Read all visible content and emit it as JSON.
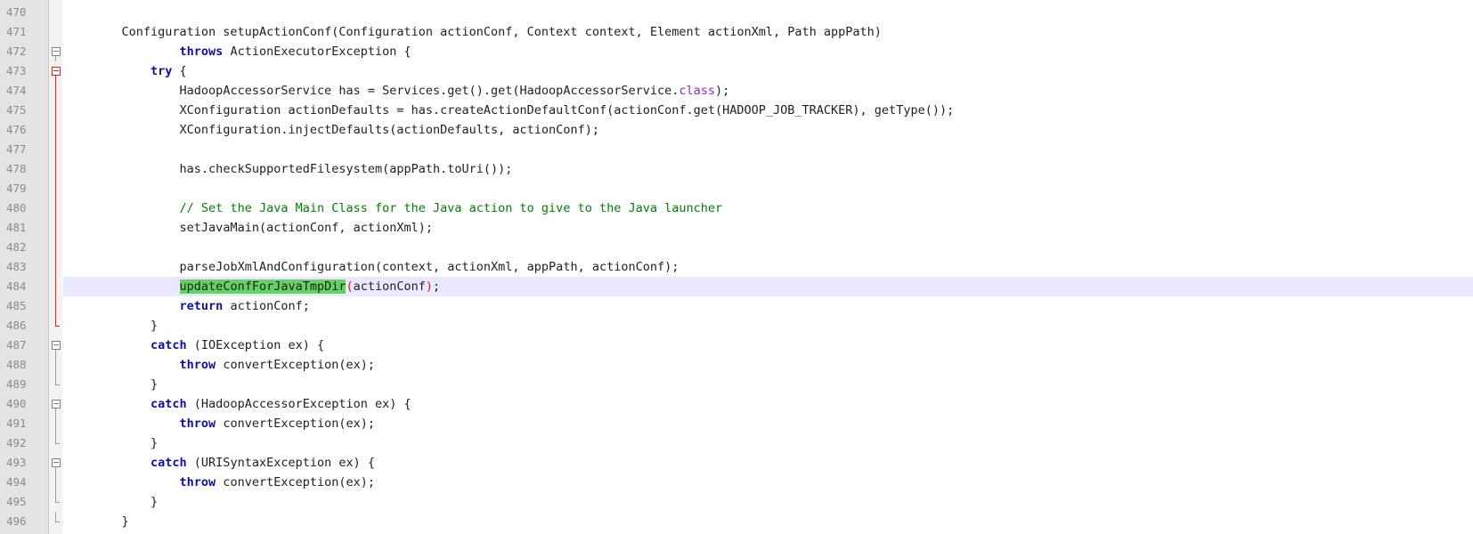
{
  "editor": {
    "lines": [
      {
        "num": "470",
        "fold": "none",
        "indent": "",
        "tokens": []
      },
      {
        "num": "471",
        "fold": "none",
        "indent": "    ",
        "tokens": [
          {
            "t": "plain",
            "v": "Configuration setupActionConf(Configuration actionConf, Context context, Element actionXml, Path appPath)"
          }
        ]
      },
      {
        "num": "472",
        "fold": "box",
        "indent": "            ",
        "tokens": [
          {
            "t": "kw",
            "v": "throws"
          },
          {
            "t": "plain",
            "v": " ActionExecutorException {"
          }
        ]
      },
      {
        "num": "473",
        "fold": "box-red",
        "indent": "        ",
        "tokens": [
          {
            "t": "kw",
            "v": "try"
          },
          {
            "t": "plain",
            "v": " {"
          }
        ]
      },
      {
        "num": "474",
        "fold": "line-red",
        "indent": "            ",
        "tokens": [
          {
            "t": "plain",
            "v": "HadoopAccessorService has = Services.get().get(HadoopAccessorService."
          },
          {
            "t": "cls",
            "v": "class"
          },
          {
            "t": "plain",
            "v": ");"
          }
        ]
      },
      {
        "num": "475",
        "fold": "line-red",
        "indent": "            ",
        "tokens": [
          {
            "t": "plain",
            "v": "XConfiguration actionDefaults = has.createActionDefaultConf(actionConf.get(HADOOP_JOB_TRACKER), getType());"
          }
        ]
      },
      {
        "num": "476",
        "fold": "line-red",
        "indent": "            ",
        "tokens": [
          {
            "t": "plain",
            "v": "XConfiguration.injectDefaults(actionDefaults, actionConf);"
          }
        ]
      },
      {
        "num": "477",
        "fold": "line-red",
        "indent": "",
        "tokens": []
      },
      {
        "num": "478",
        "fold": "line-red",
        "indent": "            ",
        "tokens": [
          {
            "t": "plain",
            "v": "has.checkSupportedFilesystem(appPath.toUri());"
          }
        ]
      },
      {
        "num": "479",
        "fold": "line-red",
        "indent": "",
        "tokens": []
      },
      {
        "num": "480",
        "fold": "line-red",
        "indent": "            ",
        "tokens": [
          {
            "t": "cmt",
            "v": "// Set the Java Main Class for the Java action to give to the Java launcher"
          }
        ]
      },
      {
        "num": "481",
        "fold": "line-red",
        "indent": "            ",
        "tokens": [
          {
            "t": "plain",
            "v": "setJavaMain(actionConf, actionXml);"
          }
        ]
      },
      {
        "num": "482",
        "fold": "line-red",
        "indent": "",
        "tokens": []
      },
      {
        "num": "483",
        "fold": "line-red",
        "indent": "            ",
        "tokens": [
          {
            "t": "plain",
            "v": "parseJobXmlAndConfiguration(context, actionXml, appPath, actionConf);"
          }
        ]
      },
      {
        "num": "484",
        "fold": "line-red",
        "indent": "            ",
        "current": true,
        "tokens": [
          {
            "t": "hl",
            "v": "updateConfForJavaTmpDir"
          },
          {
            "t": "match",
            "v": "("
          },
          {
            "t": "plain",
            "v": "actionConf"
          },
          {
            "t": "match",
            "v": ")"
          },
          {
            "t": "plain",
            "v": ";"
          }
        ]
      },
      {
        "num": "485",
        "fold": "line-red",
        "indent": "            ",
        "tokens": [
          {
            "t": "kw",
            "v": "return"
          },
          {
            "t": "plain",
            "v": " actionConf;"
          }
        ]
      },
      {
        "num": "486",
        "fold": "end-red",
        "indent": "        ",
        "tokens": [
          {
            "t": "plain",
            "v": "}"
          }
        ]
      },
      {
        "num": "487",
        "fold": "box",
        "indent": "        ",
        "tokens": [
          {
            "t": "kw",
            "v": "catch"
          },
          {
            "t": "plain",
            "v": " (IOException ex) {"
          }
        ]
      },
      {
        "num": "488",
        "fold": "line",
        "indent": "            ",
        "tokens": [
          {
            "t": "kw",
            "v": "throw"
          },
          {
            "t": "plain",
            "v": " convertException(ex);"
          }
        ]
      },
      {
        "num": "489",
        "fold": "end",
        "indent": "        ",
        "tokens": [
          {
            "t": "plain",
            "v": "}"
          }
        ]
      },
      {
        "num": "490",
        "fold": "box",
        "indent": "        ",
        "tokens": [
          {
            "t": "kw",
            "v": "catch"
          },
          {
            "t": "plain",
            "v": " (HadoopAccessorException ex) {"
          }
        ]
      },
      {
        "num": "491",
        "fold": "line",
        "indent": "            ",
        "tokens": [
          {
            "t": "kw",
            "v": "throw"
          },
          {
            "t": "plain",
            "v": " convertException(ex);"
          }
        ]
      },
      {
        "num": "492",
        "fold": "end",
        "indent": "        ",
        "tokens": [
          {
            "t": "plain",
            "v": "}"
          }
        ]
      },
      {
        "num": "493",
        "fold": "box",
        "indent": "        ",
        "tokens": [
          {
            "t": "kw",
            "v": "catch"
          },
          {
            "t": "plain",
            "v": " (URISyntaxException ex) {"
          }
        ]
      },
      {
        "num": "494",
        "fold": "line",
        "indent": "            ",
        "tokens": [
          {
            "t": "kw",
            "v": "throw"
          },
          {
            "t": "plain",
            "v": " convertException(ex);"
          }
        ]
      },
      {
        "num": "495",
        "fold": "end",
        "indent": "        ",
        "tokens": [
          {
            "t": "plain",
            "v": "}"
          }
        ]
      },
      {
        "num": "496",
        "fold": "end",
        "indent": "    ",
        "tokens": [
          {
            "t": "plain",
            "v": "}"
          }
        ]
      }
    ],
    "colors": {
      "keyword": "#1010a0",
      "class_keyword": "#8a2be2",
      "comment": "#008000",
      "word_highlight": "#64d264",
      "brace_match": "#e01010",
      "current_line": "#e8e8ff",
      "gutter": "#e4e4e4",
      "fold_active": "#e02020"
    }
  }
}
